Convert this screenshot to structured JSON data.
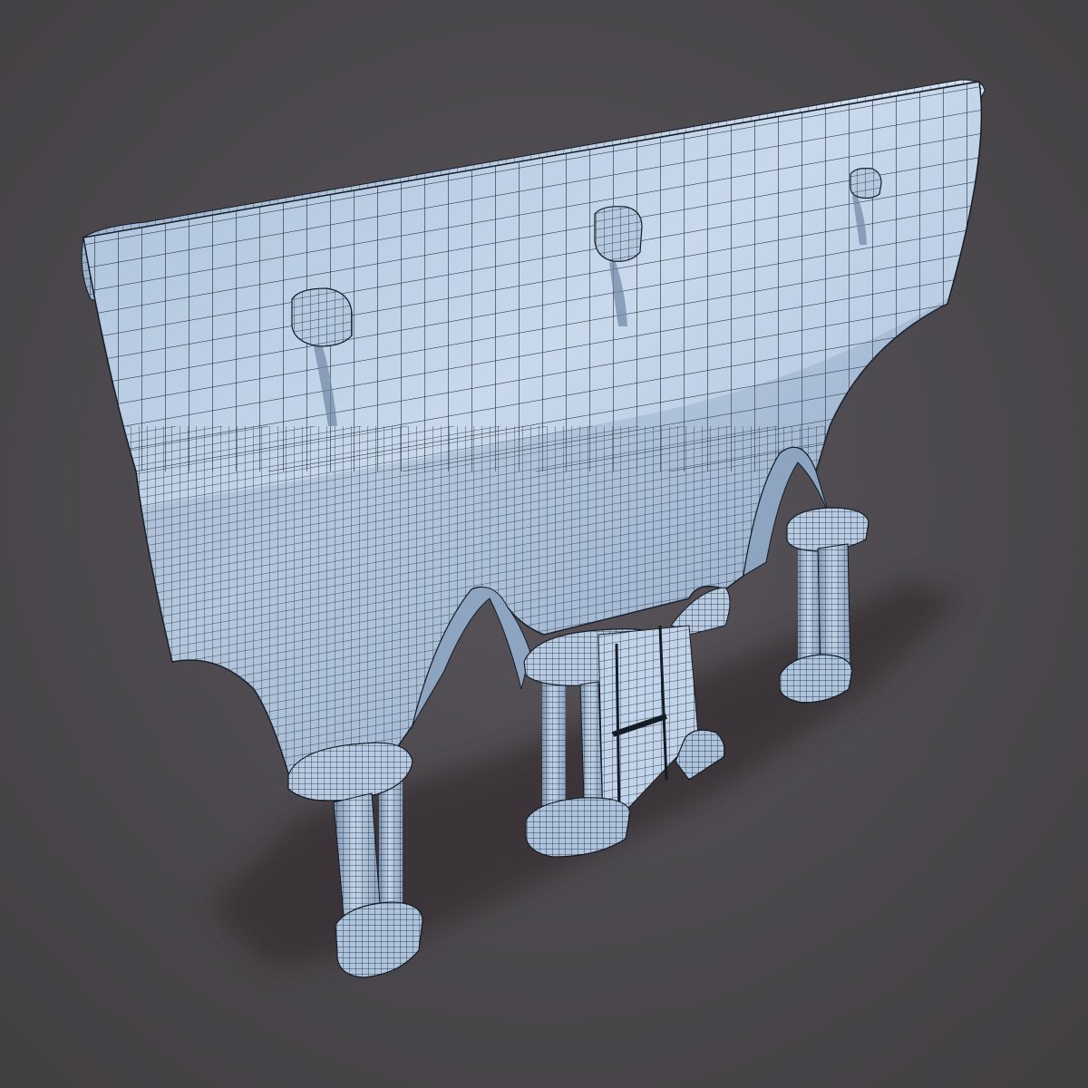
{
  "scene": {
    "subject": "arcade-wall-wireframe-render",
    "background_color": "#4a4648",
    "surface_color": "#b9cde4",
    "surface_shadow_color": "#6f86a3",
    "wire_color": "#141c26",
    "ground_shadow_color": "#3a3337",
    "arch_count": 2,
    "corbel_count": 3,
    "column_pair_count": 3
  }
}
